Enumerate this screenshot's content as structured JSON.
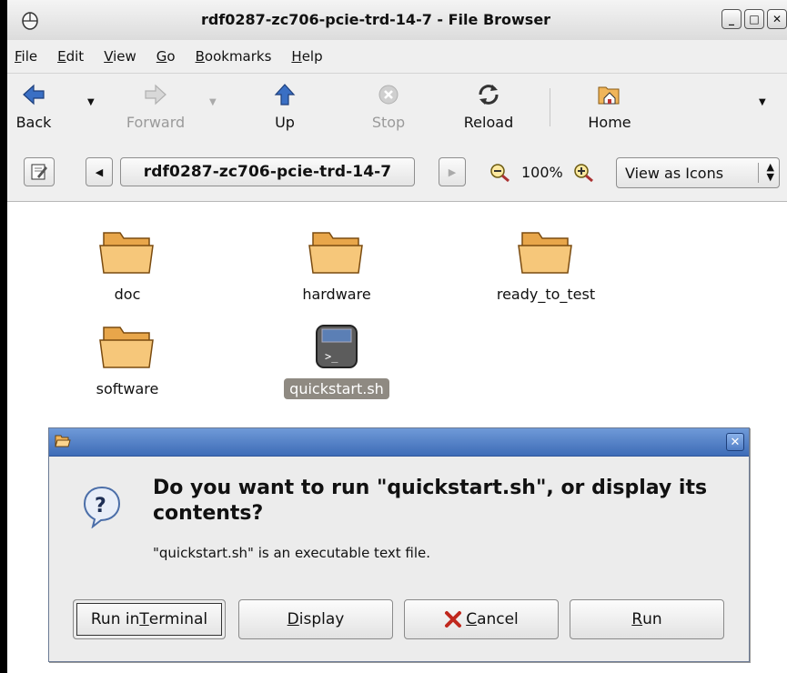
{
  "window": {
    "title": "rdf0287-zc706-pcie-trd-14-7 - File Browser",
    "app_icon": "mouse-icon",
    "controls": {
      "minimize": "_",
      "maximize": "□",
      "close": "✕"
    }
  },
  "menubar": {
    "items": [
      {
        "key": "F",
        "rest": "ile"
      },
      {
        "key": "E",
        "rest": "dit"
      },
      {
        "key": "V",
        "rest": "iew"
      },
      {
        "key": "G",
        "rest": "o"
      },
      {
        "key": "B",
        "rest": "ookmarks"
      },
      {
        "key": "H",
        "rest": "elp"
      }
    ]
  },
  "toolbar": {
    "back": "Back",
    "forward": "Forward",
    "up": "Up",
    "stop": "Stop",
    "reload": "Reload",
    "home": "Home"
  },
  "location": {
    "path_button": "rdf0287-zc706-pcie-trd-14-7",
    "zoom": "100%",
    "view_mode": "View as Icons"
  },
  "files": [
    {
      "name": "doc",
      "type": "folder"
    },
    {
      "name": "hardware",
      "type": "folder"
    },
    {
      "name": "ready_to_test",
      "type": "folder"
    },
    {
      "name": "software",
      "type": "folder"
    },
    {
      "name": "quickstart.sh",
      "type": "script",
      "selected": true
    }
  ],
  "dialog": {
    "primary_text": "Do you want to run \"quickstart.sh\", or display its contents?",
    "secondary_text": "\"quickstart.sh\" is an executable text file.",
    "close": "✕",
    "buttons": {
      "run_in_terminal": {
        "before": "Run in ",
        "key": "T",
        "after": "erminal"
      },
      "display": {
        "before": "",
        "key": "D",
        "after": "isplay"
      },
      "cancel": {
        "before": "",
        "key": "C",
        "after": "ancel"
      },
      "run": {
        "before": "",
        "key": "R",
        "after": "un"
      }
    }
  },
  "colors": {
    "dialog_title": "#4a78c2",
    "selection": "#8f8a82",
    "folder": "#f2b65c"
  }
}
